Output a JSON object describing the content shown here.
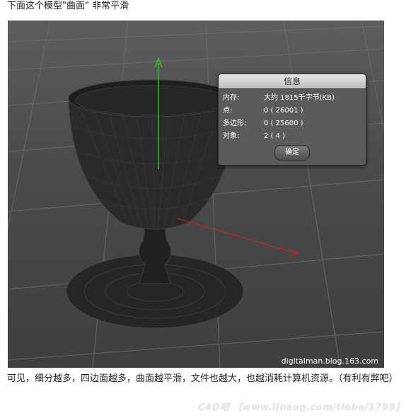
{
  "caption_top": "下面这个模型\"曲面\" 非常平滑",
  "viewport": {
    "watermark": "digitalman.blog.163.com"
  },
  "info_dialog": {
    "title": "信息",
    "rows": [
      {
        "label": "内存:",
        "value": "大约 1815千字节(KB)"
      },
      {
        "label": "点:",
        "value": "0 ( 26001 )"
      },
      {
        "label": "多边形:",
        "value": "0 ( 25600 )"
      },
      {
        "label": "对象:",
        "value": "2 ( 4 )"
      }
    ],
    "ok_label": "确定"
  },
  "body_text": "可见，细分越多，四边面越多，曲面越平滑，文件也越大，也越消耗计算机资源。（有利有弊吧）",
  "footer_watermark": "C4D吧 【www.lineeg.com/tieba/1799】",
  "colors": {
    "axis_y": "#2fbf2f",
    "axis_x": "#d02020",
    "mesh": "#1e1e1e",
    "wire": "#6a6a6a"
  }
}
